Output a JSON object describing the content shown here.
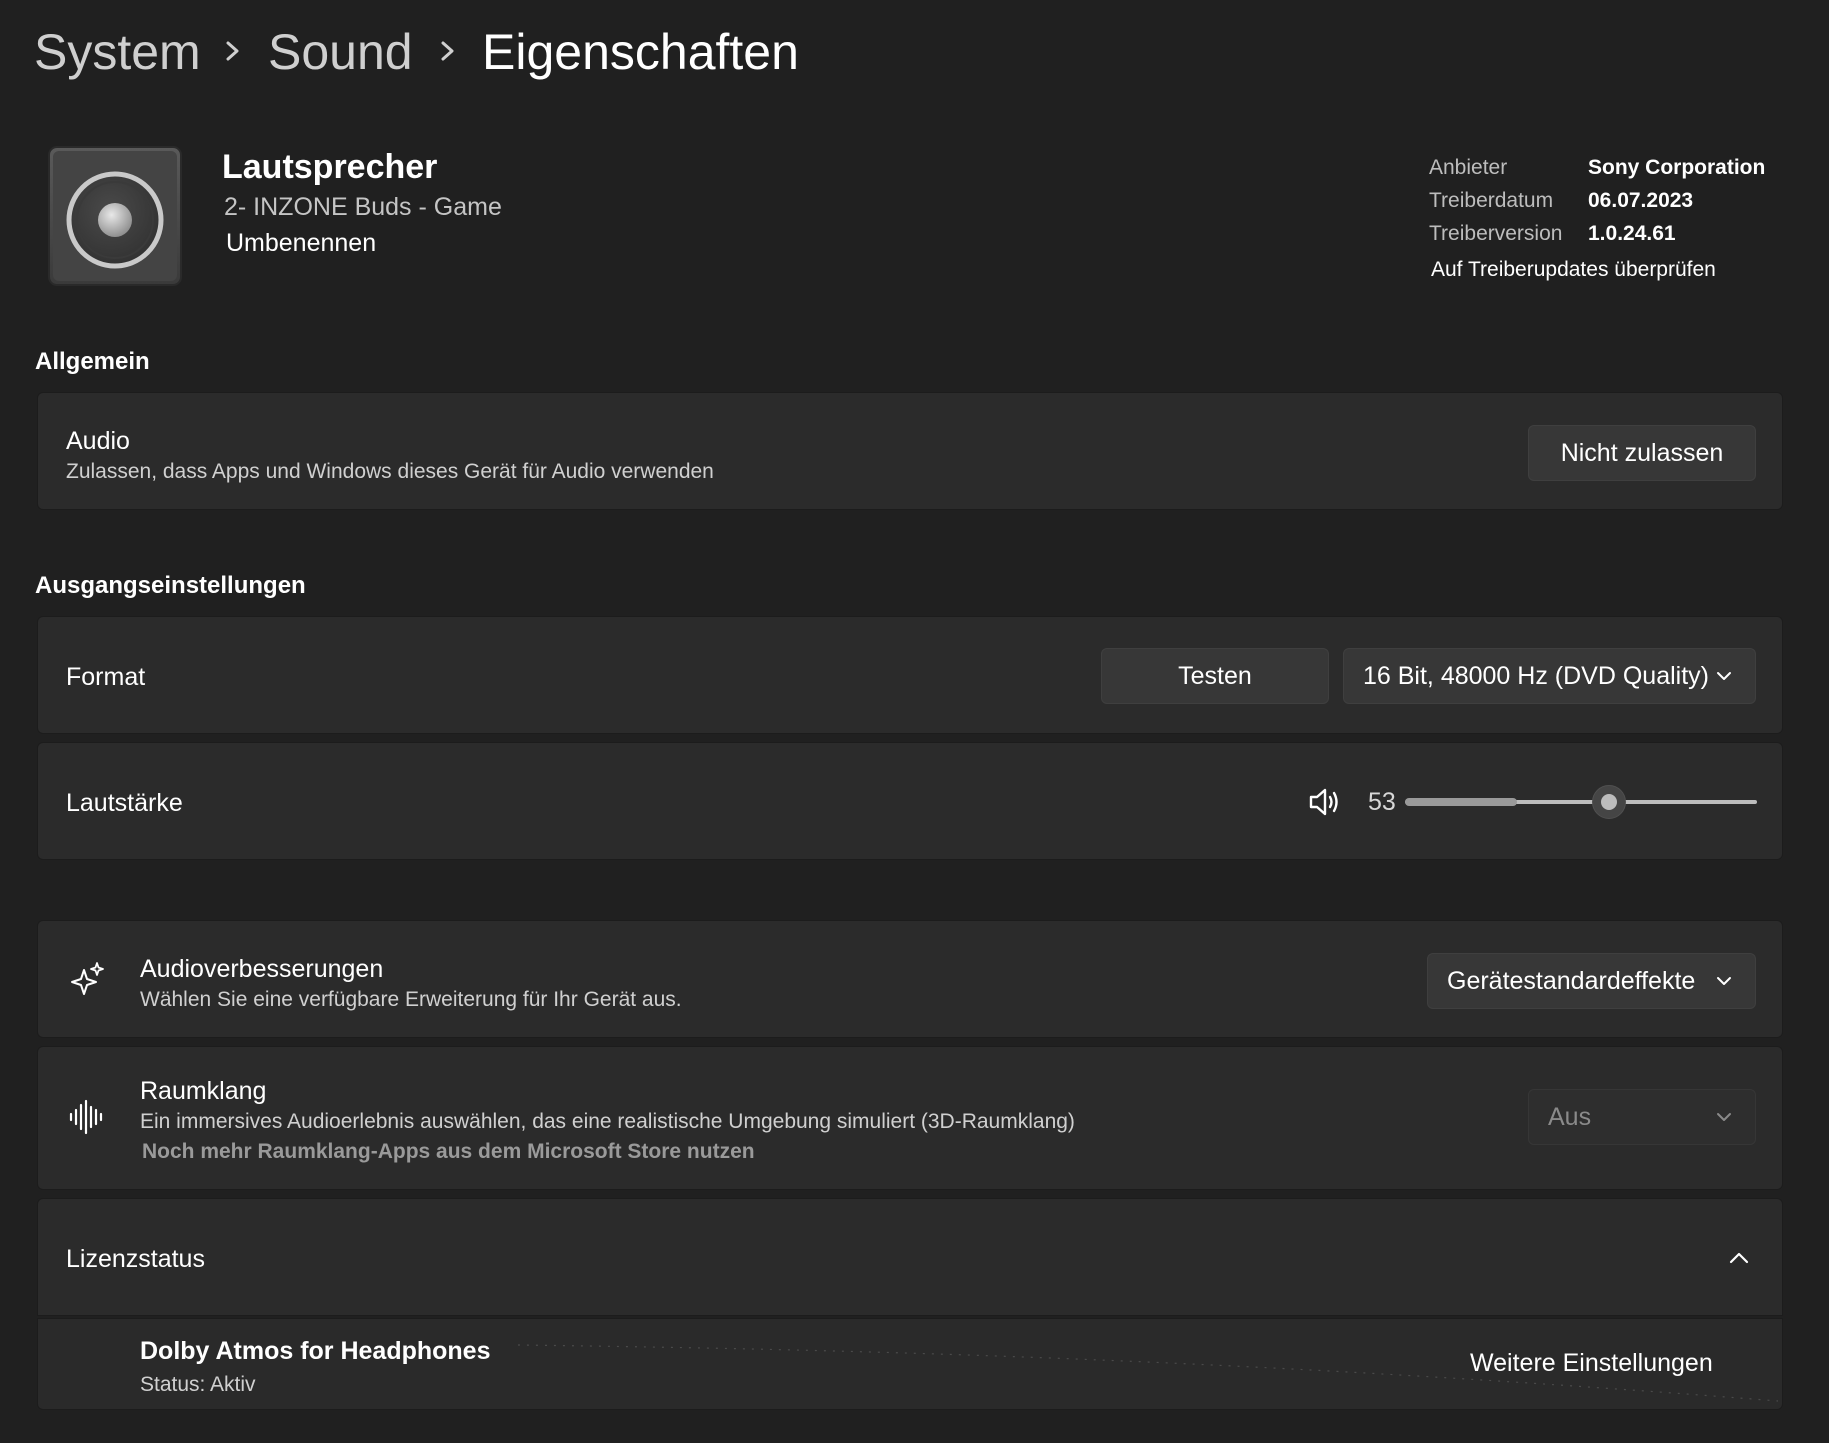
{
  "breadcrumb": {
    "items": [
      "System",
      "Sound"
    ],
    "current": "Eigenschaften"
  },
  "device": {
    "name": "Lautsprecher",
    "subtitle": "2- INZONE Buds - Game",
    "rename_label": "Umbenennen",
    "icon": "speaker-device-icon"
  },
  "driver": {
    "rows": [
      {
        "label": "Anbieter",
        "value": "Sony Corporation"
      },
      {
        "label": "Treiberdatum",
        "value": "06.07.2023"
      },
      {
        "label": "Treiberversion",
        "value": "1.0.24.61"
      }
    ],
    "update_link": "Auf Treiberupdates überprüfen"
  },
  "general": {
    "heading": "Allgemein",
    "audio": {
      "title": "Audio",
      "description": "Zulassen, dass Apps und Windows dieses Gerät für Audio verwenden",
      "button": "Nicht zulassen"
    }
  },
  "output": {
    "heading": "Ausgangseinstellungen",
    "format": {
      "title": "Format",
      "test_button": "Testen",
      "selected": "16 Bit, 48000 Hz (DVD Quality)"
    },
    "volume": {
      "title": "Lautstärke",
      "value": "53",
      "level": 0.53,
      "icon": "speaker-volume-icon"
    }
  },
  "enhancements": {
    "title": "Audioverbesserungen",
    "description": "Wählen Sie eine verfügbare Erweiterung für Ihr Gerät aus.",
    "selected": "Gerätestandardeffekte",
    "icon": "sparkle-icon"
  },
  "spatial": {
    "title": "Raumklang",
    "description": "Ein immersives Audioerlebnis auswählen, das eine realistische Umgebung simuliert (3D-Raumklang)",
    "store_link": "Noch mehr Raumklang-Apps aus dem Microsoft Store nutzen",
    "selected": "Aus",
    "icon": "soundwave-icon"
  },
  "license": {
    "title": "Lizenzstatus",
    "product": "Dolby Atmos for Headphones",
    "status": "Status: Aktiv",
    "more_settings": "Weitere Einstellungen"
  },
  "colors": {
    "background": "#202020",
    "card": "#2b2b2b",
    "control": "#373737",
    "slider_fill": "#9a9a9a",
    "slider_track": "#bdbdbd"
  }
}
